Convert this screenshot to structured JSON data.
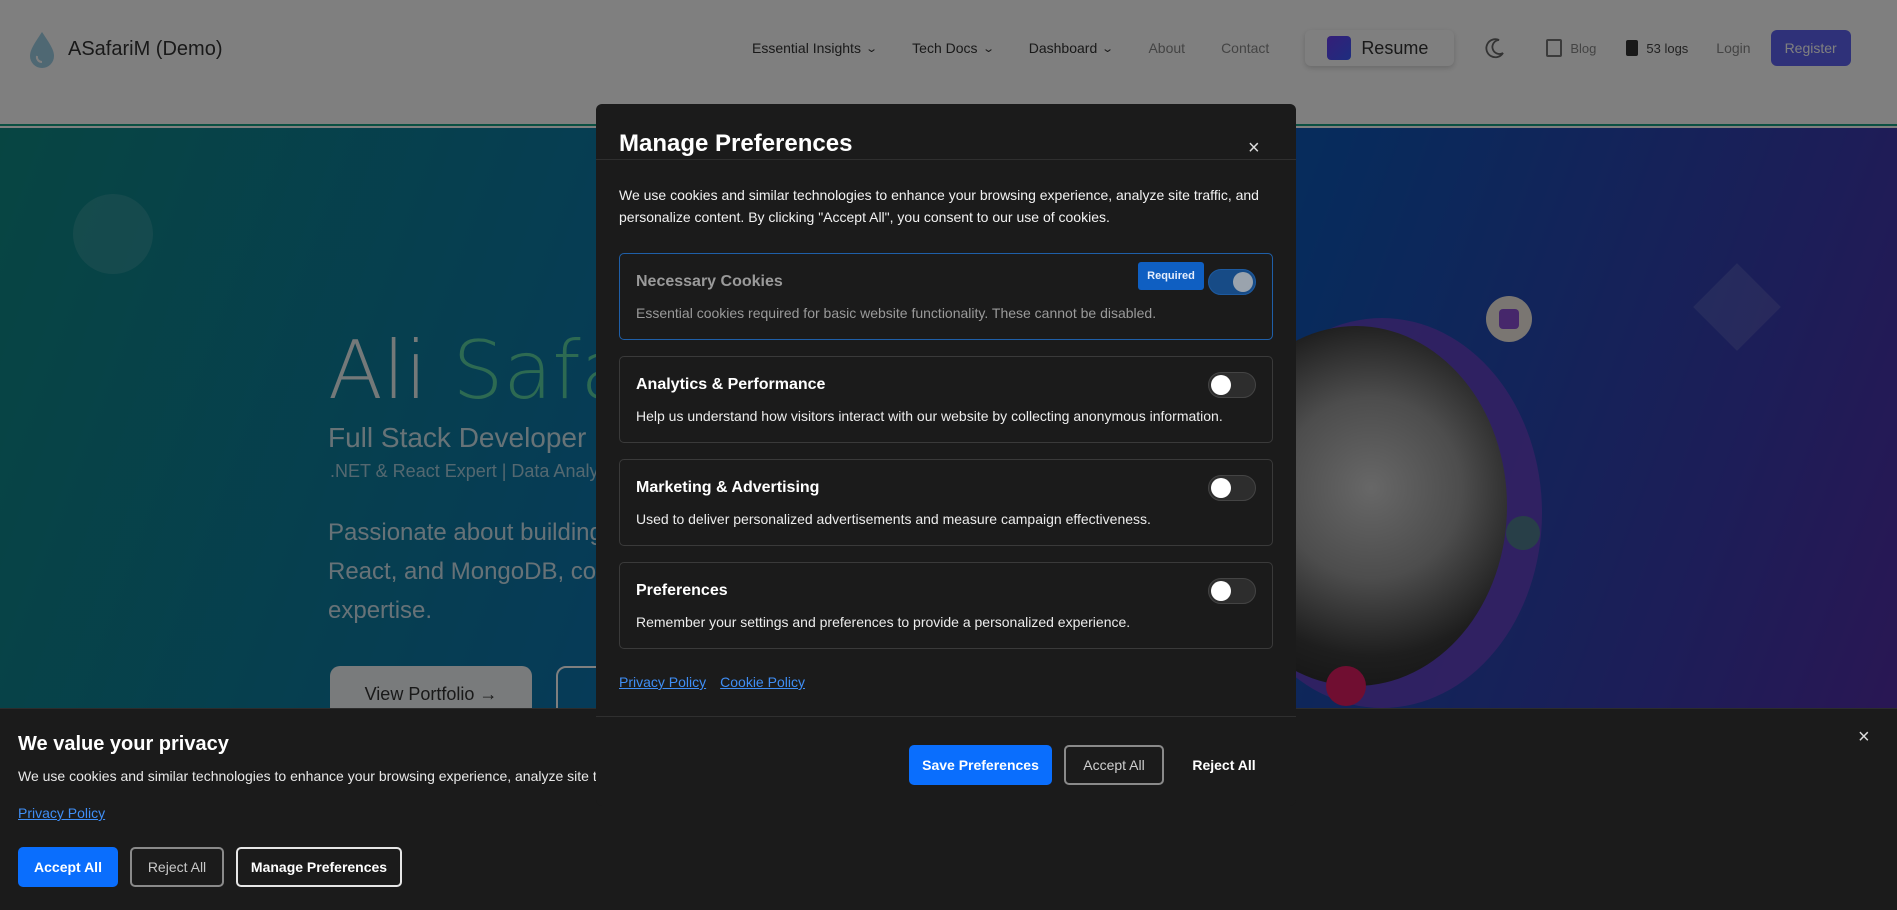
{
  "navbar": {
    "brand": "ASafariM (Demo)",
    "items": [
      {
        "label": "Essential Insights"
      },
      {
        "label": "Tech Docs"
      },
      {
        "label": "Dashboard"
      }
    ],
    "about": "About",
    "contact": "Contact",
    "resume": "Resume",
    "blog": "Blog",
    "logs": "53 logs",
    "login": "Login",
    "register": "Register"
  },
  "hero": {
    "name_first": "Ali",
    "name_last": "Safari",
    "title": "Full Stack Developer",
    "subtitle": ".NET & React Expert | Data Analyst",
    "description": "Passionate about building React, and MongoDB, co expertise.",
    "cta": "View Portfolio →"
  },
  "banner": {
    "title": "We value your privacy",
    "text": "We use cookies and similar technologies to enhance your browsing experience, analyze site traffic, and personalize content.",
    "privacy_link": "Privacy Policy",
    "accept": "Accept All",
    "reject": "Reject All",
    "manage": "Manage Preferences",
    "close": "×"
  },
  "modal": {
    "title": "Manage Preferences",
    "close": "×",
    "intro": "We use cookies and similar technologies to enhance your browsing experience, analyze site traffic, and personalize content. By clicking \"Accept All\", you consent to our use of cookies.",
    "categories": [
      {
        "title": "Necessary Cookies",
        "description": "Essential cookies required for basic website functionality. These cannot be disabled.",
        "badge": "Required",
        "enabled": true
      },
      {
        "title": "Analytics & Performance",
        "description": "Help us understand how visitors interact with our website by collecting anonymous information.",
        "enabled": false
      },
      {
        "title": "Marketing & Advertising",
        "description": "Used to deliver personalized advertisements and measure campaign effectiveness.",
        "enabled": false
      },
      {
        "title": "Preferences",
        "description": "Remember your settings and preferences to provide a personalized experience.",
        "enabled": false
      }
    ],
    "links": {
      "privacy": "Privacy Policy",
      "cookie": "Cookie Policy"
    },
    "buttons": {
      "save": "Save Preferences",
      "accept": "Accept All",
      "reject": "Reject All"
    }
  },
  "colors": {
    "accent": "#0a6efd",
    "panel_bg": "#1b1b1b",
    "link": "#3f8ef5",
    "hero_teal": "#0e8b85",
    "hero_purple": "#5b2aa6"
  }
}
